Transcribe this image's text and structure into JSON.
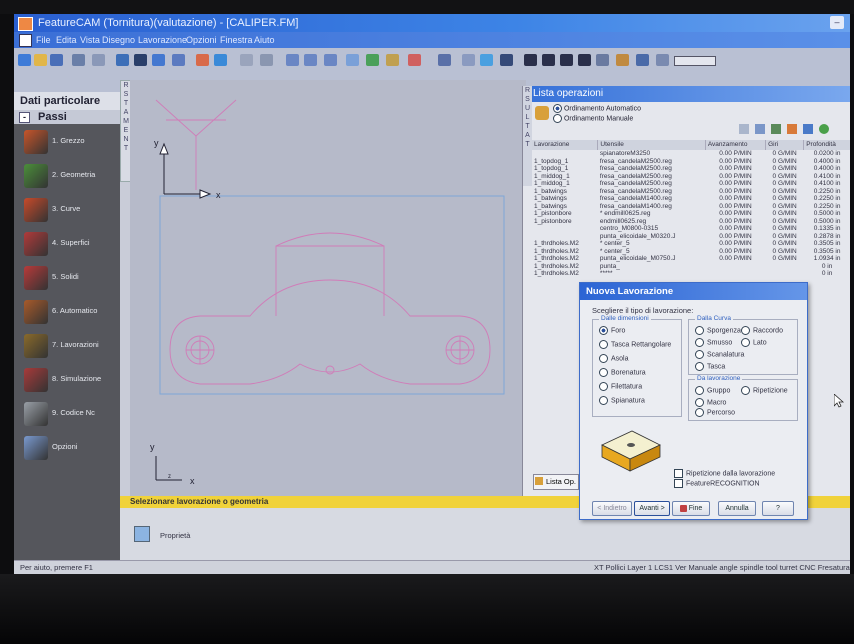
{
  "window": {
    "title": "FeatureCAM (Tornitura)(valutazione) - [CALIPER.FM]",
    "window_button": "–"
  },
  "menu": [
    "File",
    "Edita",
    "Vista",
    "Disegno",
    "Lavorazione",
    "Opzioni",
    "Finestra",
    "Aiuto"
  ],
  "left_panel": {
    "title": "Dati particolare",
    "steps_header": "Passi",
    "steps_toggle": "-",
    "steps": [
      {
        "label": "1. Grezzo",
        "icon": "stock-icon",
        "color": "#c8552a"
      },
      {
        "label": "2. Geometria",
        "icon": "geometry-icon",
        "color": "#4b8f3a"
      },
      {
        "label": "3. Curve",
        "icon": "curves-icon",
        "color": "#c84a2a"
      },
      {
        "label": "4. Superfici",
        "icon": "surfaces-icon",
        "color": "#b13a3a"
      },
      {
        "label": "5. Solidi",
        "icon": "solids-icon",
        "color": "#b83a3a"
      },
      {
        "label": "6. Automatico",
        "icon": "automatic-icon",
        "color": "#a85a2a"
      },
      {
        "label": "7. Lavorazioni",
        "icon": "operations-icon",
        "color": "#8a6a2a"
      },
      {
        "label": "8. Simulazione",
        "icon": "simulation-icon",
        "color": "#a83a3a"
      },
      {
        "label": "9. Codice Nc",
        "icon": "nc-code-icon",
        "color": "#9aa0a8"
      },
      {
        "label": "Opzioni",
        "icon": "options-icon",
        "color": "#7a9ad0"
      }
    ]
  },
  "side_tab_letters": "R S T A M E N T",
  "canvas": {
    "axis_x": "x",
    "axis_y": "y",
    "axis_z": "z"
  },
  "hint_bar": "Selezionare lavorazione o geometria",
  "properties_label": "Proprietà",
  "status_bar": {
    "left": "Per aiuto, premere F1",
    "right": "XT Pollici Layer 1 LCS1 Ver Manuale angle spindle tool turret CNC Fresatura"
  },
  "operations_panel": {
    "title": "Lista operazioni",
    "vertical_label": "R S U L T A T",
    "radio_auto": "Ordinamento Automatico",
    "radio_manual": "Ordinamento Manuale",
    "columns": [
      "Lavorazione",
      "Utensile",
      "Avanzamento",
      "Giri",
      "Profondità"
    ],
    "rows": [
      [
        "",
        "spianatoreM3250",
        "0.00 P/MIN",
        "0 G/MIN",
        "0.0200 in"
      ],
      [
        "1_topdog_1",
        "fresa_candelaM2500.reg",
        "0.00 P/MIN",
        "0 G/MIN",
        "0.4000 in"
      ],
      [
        "1_topdog_1",
        "fresa_candelaM2500.reg",
        "0.00 P/MIN",
        "0 G/MIN",
        "0.4000 in"
      ],
      [
        "1_middog_1",
        "fresa_candelaM2500.reg",
        "0.00 P/MIN",
        "0 G/MIN",
        "0.4100 in"
      ],
      [
        "1_middog_1",
        "fresa_candelaM2500.reg",
        "0.00 P/MIN",
        "0 G/MIN",
        "0.4100 in"
      ],
      [
        "1_batwings",
        "fresa_candelaM2500.reg",
        "0.00 P/MIN",
        "0 G/MIN",
        "0.2250 in"
      ],
      [
        "1_batwings",
        "fresa_candelaM1400.reg",
        "0.00 P/MIN",
        "0 G/MIN",
        "0.2250 in"
      ],
      [
        "1_batwings",
        "fresa_candelaM1400.reg",
        "0.00 P/MIN",
        "0 G/MIN",
        "0.2250 in"
      ],
      [
        "1_pistonbore",
        "* endmill0625.reg",
        "0.00 P/MIN",
        "0 G/MIN",
        "0.5000 in"
      ],
      [
        "1_pistonbore",
        "endmill0625.reg",
        "0.00 P/MIN",
        "0 G/MIN",
        "0.5000 in"
      ],
      [
        "",
        "centro_M0800-0315",
        "0.00 P/MIN",
        "0 G/MIN",
        "0.1335 in"
      ],
      [
        "",
        "punta_elicoidale_M0320.J",
        "0.00 P/MIN",
        "0 G/MIN",
        "0.2878 in"
      ],
      [
        "1_thrdholes.M2",
        "* center_5",
        "0.00 P/MIN",
        "0 G/MIN",
        "0.3505 in"
      ],
      [
        "1_thrdholes.M2",
        "* center_5",
        "0.00 P/MIN",
        "0 G/MIN",
        "0.3505 in"
      ],
      [
        "1_thrdholes.M2",
        "punta_elicoidale_M0750.J",
        "0.00 P/MIN",
        "0 G/MIN",
        "1.0934 in"
      ],
      [
        "1_thrdholes.M2",
        "punta_",
        "",
        "",
        "0 in"
      ],
      [
        "1_thrdholes.M2",
        "*****",
        "",
        "",
        "0 in"
      ]
    ],
    "tab_label": "Lista Op."
  },
  "dialog": {
    "title": "Nuova Lavorazione",
    "prompt": "Scegliere il tipo di lavorazione:",
    "group_dimension": "Dalle dimensioni",
    "options_dimension": [
      "Foro",
      "Tasca Rettangolare",
      "Asola",
      "Borenatura",
      "Filettatura",
      "Spianatura"
    ],
    "selected_dimension": "Foro",
    "group_curve": "Dalla Curva",
    "options_curve": [
      "Sporgenza",
      "Raccordo",
      "Smusso",
      "Lato",
      "Scanalatura",
      "Tasca"
    ],
    "group_ops": "Da lavorazione",
    "options_ops": [
      "Gruppo",
      "Ripetizione",
      "Macro",
      "Percorso"
    ],
    "check_repeat": "Ripetizione dalla lavorazione",
    "check_recognition": "FeatureRECOGNITION",
    "buttons": {
      "back": "< Indietro",
      "next": "Avanti >",
      "finish": "Fine",
      "cancel": "Annulla",
      "help": "?"
    }
  }
}
